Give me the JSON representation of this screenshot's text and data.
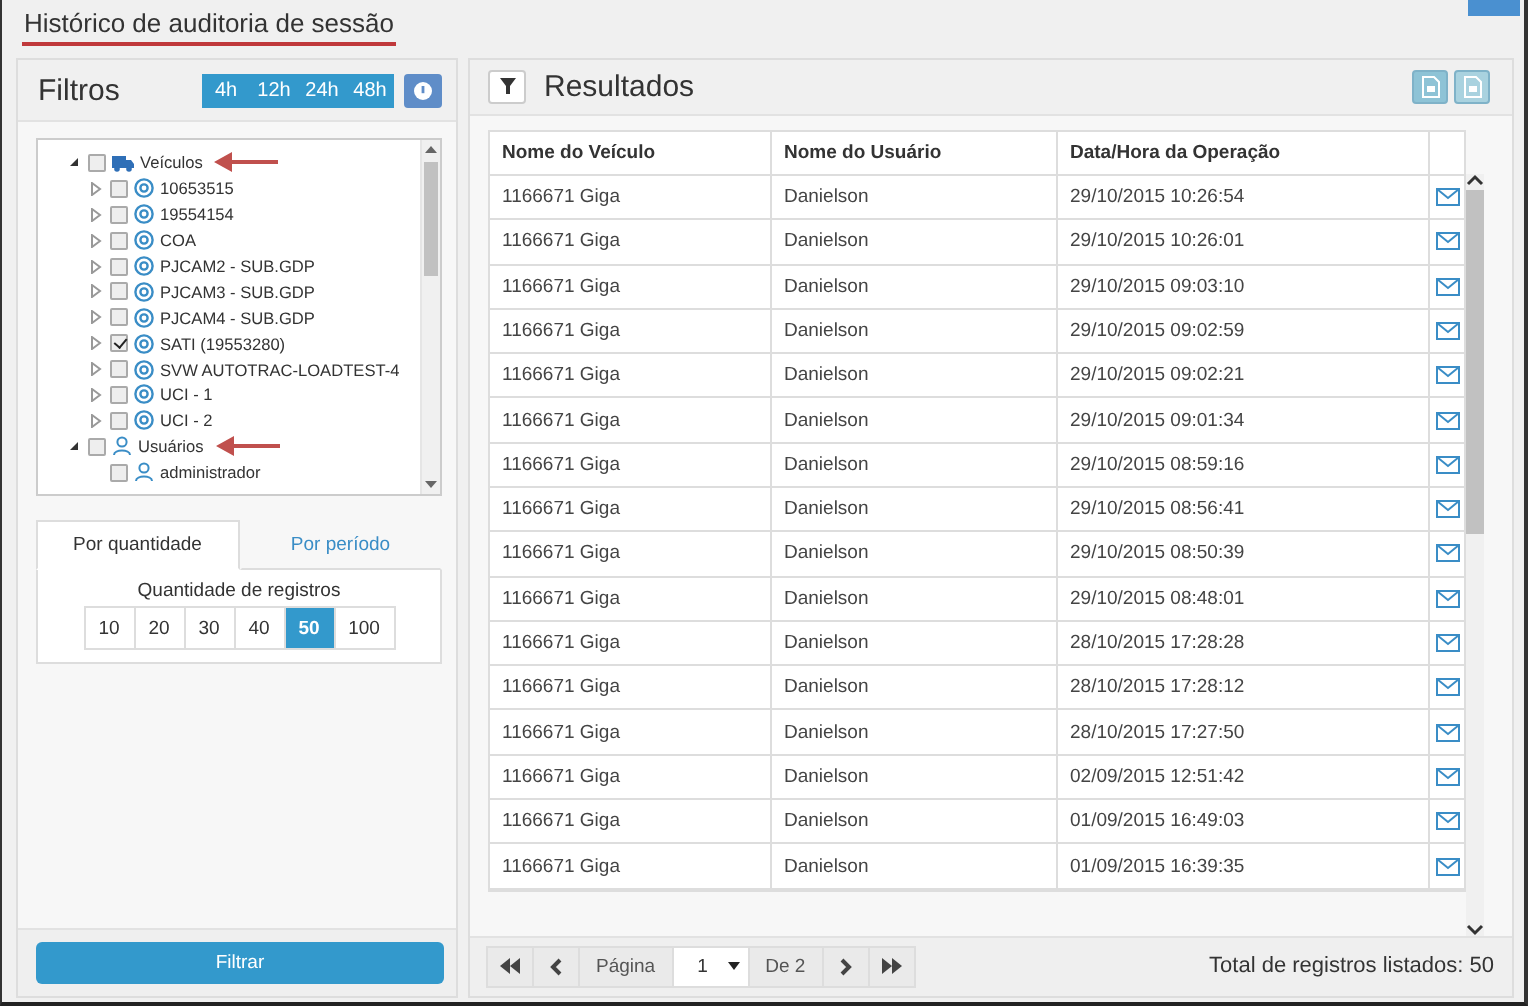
{
  "page": {
    "title": "Histórico de auditoria de sessão"
  },
  "filters": {
    "title": "Filtros",
    "time_buttons": [
      {
        "label": "4h",
        "selected": false
      },
      {
        "label": "12h",
        "selected": false
      },
      {
        "label": "24h",
        "selected": false
      },
      {
        "label": "48h",
        "selected": false
      }
    ],
    "tree": [
      {
        "label": "Veículos",
        "kind": "vehicles",
        "checked": false,
        "expanded": true,
        "annotated": true,
        "children": [
          {
            "label": "10653515",
            "kind": "vehicle",
            "checked": false,
            "expanded": false
          },
          {
            "label": "19554154",
            "kind": "vehicle",
            "checked": false,
            "expanded": false
          },
          {
            "label": "COA",
            "kind": "vehicle",
            "checked": false,
            "expanded": false
          },
          {
            "label": "PJCAM2 - SUB.GDP",
            "kind": "vehicle",
            "checked": false,
            "expanded": false
          },
          {
            "label": "PJCAM3 - SUB.GDP",
            "kind": "vehicle",
            "checked": false,
            "expanded": false
          },
          {
            "label": "PJCAM4 - SUB.GDP",
            "kind": "vehicle",
            "checked": false,
            "expanded": false
          },
          {
            "label": "SATI (19553280)",
            "kind": "vehicle",
            "checked": true,
            "expanded": false
          },
          {
            "label": "SVW AUTOTRAC-LOADTEST-4",
            "kind": "vehicle",
            "checked": false,
            "expanded": false
          },
          {
            "label": "UCI - 1",
            "kind": "vehicle",
            "checked": false,
            "expanded": false
          },
          {
            "label": "UCI - 2",
            "kind": "vehicle",
            "checked": false,
            "expanded": false
          }
        ]
      },
      {
        "label": "Usuários",
        "kind": "users",
        "checked": false,
        "expanded": true,
        "annotated": true,
        "children": [
          {
            "label": "administrador",
            "kind": "user",
            "checked": false
          }
        ]
      }
    ],
    "tabs": [
      {
        "label": "Por quantidade",
        "selected": true
      },
      {
        "label": "Por período",
        "selected": false
      }
    ],
    "quantity": {
      "label": "Quantidade de registros",
      "options": [
        {
          "label": "10",
          "selected": false
        },
        {
          "label": "20",
          "selected": false
        },
        {
          "label": "30",
          "selected": false
        },
        {
          "label": "40",
          "selected": false
        },
        {
          "label": "50",
          "selected": true
        },
        {
          "label": "100",
          "selected": false
        }
      ]
    },
    "filter_button": "Filtrar"
  },
  "results": {
    "title": "Resultados",
    "columns": [
      "Nome do Veículo",
      "Nome do Usuário",
      "Data/Hora da Operação"
    ],
    "rows": [
      {
        "vehicle": "1166671 Giga",
        "user": "Danielson",
        "datetime": "29/10/2015 10:26:54"
      },
      {
        "vehicle": "1166671 Giga",
        "user": "Danielson",
        "datetime": "29/10/2015 10:26:01"
      },
      {
        "vehicle": "1166671 Giga",
        "user": "Danielson",
        "datetime": "29/10/2015 09:03:10"
      },
      {
        "vehicle": "1166671 Giga",
        "user": "Danielson",
        "datetime": "29/10/2015 09:02:59"
      },
      {
        "vehicle": "1166671 Giga",
        "user": "Danielson",
        "datetime": "29/10/2015 09:02:21"
      },
      {
        "vehicle": "1166671 Giga",
        "user": "Danielson",
        "datetime": "29/10/2015 09:01:34"
      },
      {
        "vehicle": "1166671 Giga",
        "user": "Danielson",
        "datetime": "29/10/2015 08:59:16"
      },
      {
        "vehicle": "1166671 Giga",
        "user": "Danielson",
        "datetime": "29/10/2015 08:56:41"
      },
      {
        "vehicle": "1166671 Giga",
        "user": "Danielson",
        "datetime": "29/10/2015 08:50:39"
      },
      {
        "vehicle": "1166671 Giga",
        "user": "Danielson",
        "datetime": "29/10/2015 08:48:01"
      },
      {
        "vehicle": "1166671 Giga",
        "user": "Danielson",
        "datetime": "28/10/2015 17:28:28"
      },
      {
        "vehicle": "1166671 Giga",
        "user": "Danielson",
        "datetime": "28/10/2015 17:28:12"
      },
      {
        "vehicle": "1166671 Giga",
        "user": "Danielson",
        "datetime": "28/10/2015 17:27:50"
      },
      {
        "vehicle": "1166671 Giga",
        "user": "Danielson",
        "datetime": "02/09/2015 12:51:42"
      },
      {
        "vehicle": "1166671 Giga",
        "user": "Danielson",
        "datetime": "01/09/2015 16:49:03"
      },
      {
        "vehicle": "1166671 Giga",
        "user": "Danielson",
        "datetime": "01/09/2015 16:39:35"
      }
    ],
    "pagination": {
      "page_label": "Página",
      "page": "1",
      "of": "De 2"
    },
    "total": "Total de registros listados: 50"
  }
}
